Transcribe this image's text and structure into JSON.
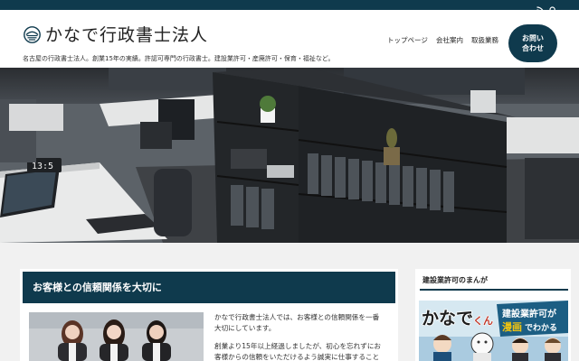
{
  "colors": {
    "brand": "#0f3a4d",
    "background": "#f1f1f1",
    "text": "#222222"
  },
  "topbar": {
    "icons": [
      "rss-icon",
      "search-icon"
    ]
  },
  "header": {
    "logo": "kanade-emblem-logo",
    "site_title": "かなで行政書士法人",
    "tagline": "名古屋の行政書士法人。創業15年の実績。許認可専門の行政書士。建設業許可・産廃許可・保育・福祉など。"
  },
  "nav": {
    "items": [
      {
        "label": "トップページ"
      },
      {
        "label": "会社案内"
      },
      {
        "label": "取扱業務"
      }
    ],
    "contact_line1": "お問い",
    "contact_line2": "合わせ"
  },
  "hero": {
    "clock": "13:5"
  },
  "main": {
    "heading": "お客様との信頼関係を大切に",
    "paragraphs": [
      "かなで行政書士法人では、お客様との信頼関係を一番",
      "大切にしています。",
      "創業より15年以上経過しましたが、初心を忘れずにお",
      "客様からの信頼をいただけるよう誠実に仕事すること"
    ]
  },
  "sidebar": {
    "title": "建設業許可のまんが",
    "comic": {
      "title_part1": "かなで",
      "title_part2": "くん",
      "caption_line1": "建設業許可が",
      "caption_line2_a": "漫画",
      "caption_line2_b": "でわかる"
    }
  }
}
